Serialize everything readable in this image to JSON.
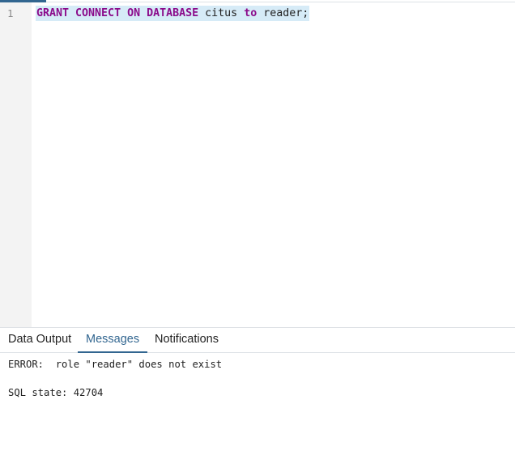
{
  "editor": {
    "line_numbers": [
      "1"
    ],
    "code": {
      "kw1": "GRANT CONNECT ON DATABASE",
      "ident1": " citus ",
      "kw2": "to",
      "ident2": " reader;"
    }
  },
  "results": {
    "tabs": [
      {
        "label": "Data Output",
        "active": false
      },
      {
        "label": "Messages",
        "active": true
      },
      {
        "label": "Notifications",
        "active": false
      }
    ],
    "messages": {
      "error": "ERROR:  role \"reader\" does not exist",
      "sql_state": "SQL state: 42704"
    }
  },
  "colors": {
    "accent": "#326690",
    "keyword": "#8b0b8b",
    "selection": "#d6ebf7",
    "gutter": "#f3f3f3"
  }
}
